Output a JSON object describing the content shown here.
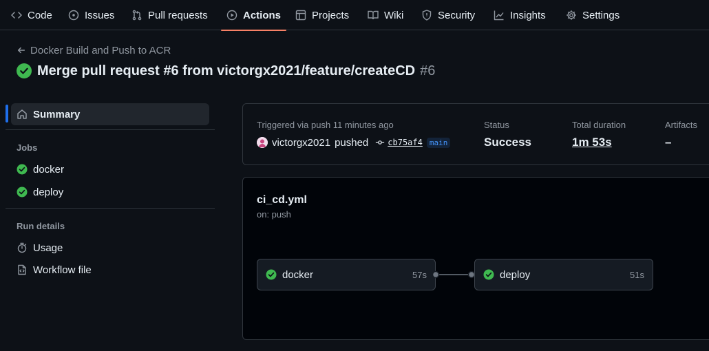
{
  "nav": {
    "tabs": [
      {
        "label": "Code",
        "icon": "code-icon"
      },
      {
        "label": "Issues",
        "icon": "issue-opened-icon"
      },
      {
        "label": "Pull requests",
        "icon": "git-pull-request-icon"
      },
      {
        "label": "Actions",
        "icon": "play-icon",
        "active": true
      },
      {
        "label": "Projects",
        "icon": "table-icon"
      },
      {
        "label": "Wiki",
        "icon": "book-icon"
      },
      {
        "label": "Security",
        "icon": "shield-icon"
      },
      {
        "label": "Insights",
        "icon": "graph-icon"
      },
      {
        "label": "Settings",
        "icon": "gear-icon"
      }
    ]
  },
  "header": {
    "back_label": "Docker Build and Push to ACR",
    "title": "Merge pull request #6 from victorgx2021/feature/createCD",
    "run_number": "#6"
  },
  "sidebar": {
    "summary_label": "Summary",
    "jobs_heading": "Jobs",
    "jobs": [
      {
        "label": "docker"
      },
      {
        "label": "deploy"
      }
    ],
    "run_details_heading": "Run details",
    "run_details": [
      {
        "label": "Usage",
        "icon": "stopwatch-icon"
      },
      {
        "label": "Workflow file",
        "icon": "file-code-icon"
      }
    ]
  },
  "summary": {
    "trigger_label": "Triggered via push 11 minutes ago",
    "actor": "victorgx2021",
    "action": "pushed",
    "commit": "cb75af4",
    "branch": "main",
    "status_label": "Status",
    "status_value": "Success",
    "duration_label": "Total duration",
    "duration_value": "1m 53s",
    "artifacts_label": "Artifacts",
    "artifacts_value": "–"
  },
  "workflow": {
    "file": "ci_cd.yml",
    "trigger": "on: push",
    "jobs": [
      {
        "name": "docker",
        "duration": "57s"
      },
      {
        "name": "deploy",
        "duration": "51s"
      }
    ]
  },
  "colors": {
    "background": "#0d1117",
    "success": "#3fb950",
    "accent_underline": "#f78166",
    "link_blue": "#4493f8"
  }
}
